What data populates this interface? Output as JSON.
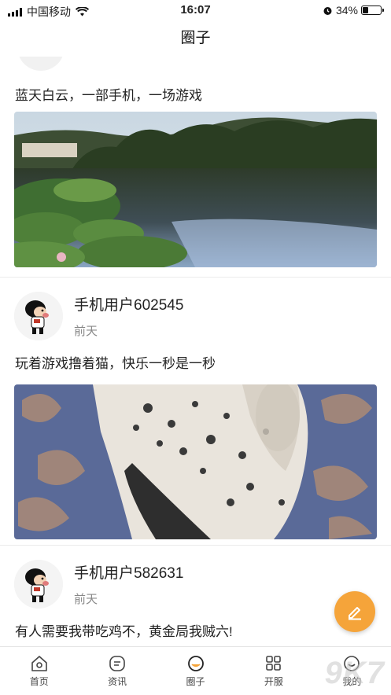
{
  "status_bar": {
    "carrier": "中国移动",
    "time": "16:07",
    "battery": "34%",
    "battery_level": 0.34
  },
  "header": {
    "title": "圈子"
  },
  "posts": [
    {
      "text": "蓝天白云，一部手机，一场游戏",
      "image": "lake-photo"
    },
    {
      "user": "手机用户602545",
      "time": "前天",
      "text": "玩着游戏撸着猫，快乐一秒是一秒",
      "image": "cat-photo"
    },
    {
      "user": "手机用户582631",
      "time": "前天",
      "text": "有人需要我带吃鸡不，黄金局我贼六!"
    }
  ],
  "tabbar": [
    {
      "label": "首页",
      "icon": "home-icon"
    },
    {
      "label": "资讯",
      "icon": "news-icon"
    },
    {
      "label": "圈子",
      "icon": "circle-icon",
      "active": true
    },
    {
      "label": "开服",
      "icon": "server-icon"
    },
    {
      "label": "我的",
      "icon": "profile-icon"
    }
  ],
  "watermark": "9K7",
  "colors": {
    "accent": "#f5a43a"
  }
}
